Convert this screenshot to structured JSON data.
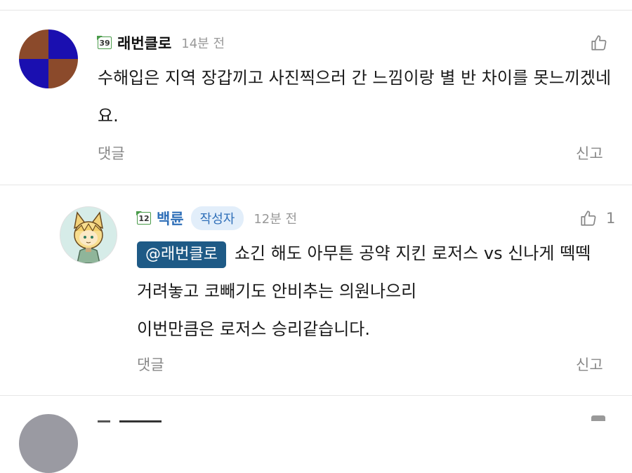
{
  "comments": [
    {
      "nickname": "래번클로",
      "level": "39",
      "time": "14분 전",
      "text": "수해입은 지역 장갑끼고 사진찍으러 간 느낌이랑 별 반 차이를 못느끼겠네요.",
      "reply_label": "댓글",
      "report_label": "신고"
    },
    {
      "nickname": "백륜",
      "level": "12",
      "author_tag": "작성자",
      "time": "12분 전",
      "like_count": "1",
      "mention": "@래번클로",
      "text_line1": "쇼긴 해도 아무튼 공약 지킨 로저스 vs 신나게 떽떽",
      "text_line2": "거려놓고 코빼기도 안비추는 의원나으리",
      "text_line3": "이번만큼은 로저스 승리같습니다.",
      "reply_label": "댓글",
      "report_label": "신고"
    }
  ]
}
